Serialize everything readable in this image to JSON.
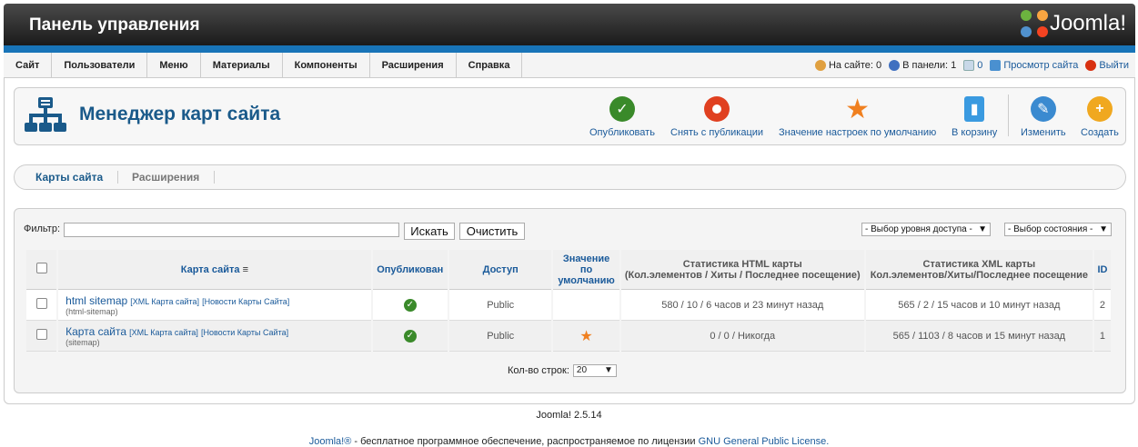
{
  "header": {
    "title": "Панель управления",
    "logo_text": "Joomla!"
  },
  "menu": [
    {
      "name": "menu-site",
      "label": "Сайт"
    },
    {
      "name": "menu-users",
      "label": "Пользователи"
    },
    {
      "name": "menu-menus",
      "label": "Меню"
    },
    {
      "name": "menu-content",
      "label": "Материалы"
    },
    {
      "name": "menu-components",
      "label": "Компоненты"
    },
    {
      "name": "menu-extensions",
      "label": "Расширения"
    },
    {
      "name": "menu-help",
      "label": "Справка"
    }
  ],
  "status": {
    "on_site": "На сайте: 0",
    "in_panel": "В панели: 1",
    "messages": "0",
    "view_site": "Просмотр сайта",
    "logout": "Выйти"
  },
  "page": {
    "title": "Менеджер карт сайта"
  },
  "toolbar": {
    "publish": "Опубликовать",
    "unpublish": "Снять с публикации",
    "default": "Значение настроек по умолчанию",
    "trash": "В корзину",
    "edit": "Изменить",
    "create": "Создать"
  },
  "tabs": {
    "sitemaps": "Карты сайта",
    "extensions": "Расширения"
  },
  "filter": {
    "label": "Фильтр:",
    "value": "",
    "search": "Искать",
    "clear": "Очистить",
    "access": "- Выбор уровня доступа -",
    "state": "- Выбор состояния -"
  },
  "table": {
    "headers": {
      "sitemap": "Карта сайта",
      "published": "Опубликован",
      "access": "Доступ",
      "default_1": "Значение",
      "default_2": "по",
      "default_3": "умолчанию",
      "html_1": "Статистика HTML карты",
      "html_2": "(Кол.элементов / Хиты / Последнее посещение)",
      "xml_1": "Статистика XML карты",
      "xml_2": "Кол.элементов/Хиты/Последнее посещение",
      "id": "ID"
    },
    "rows": [
      {
        "name": "html sitemap",
        "link_xml": "[XML Карта сайта]",
        "link_news": "[Новости Карты Сайта]",
        "alias": "(html-sitemap)",
        "access": "Public",
        "is_default": false,
        "html_stats": "580 / 10 / 6 часов и 23 минут назад",
        "xml_stats": "565 / 2 / 15 часов и 10 минут назад",
        "id": "2"
      },
      {
        "name": "Карта сайта",
        "link_xml": "[XML Карта сайта]",
        "link_news": "[Новости Карты Сайта]",
        "alias": "(sitemap)",
        "access": "Public",
        "is_default": true,
        "html_stats": "0 / 0 / Никогда",
        "xml_stats": "565 / 1103 / 8 часов и 15 минут назад",
        "id": "1"
      }
    ]
  },
  "pager": {
    "label": "Кол-во строк:",
    "value": "20"
  },
  "footer": {
    "version": "Joomla! 2.5.14",
    "license_pre": "Joomla!®",
    "license_mid": " - бесплатное программное обеспечение, распространяемое по лицензии ",
    "license_link": "GNU General Public License."
  },
  "colors": {
    "accent_blue": "#1874b8",
    "publish_green": "#3a8a2a",
    "unpublish_red": "#e04020",
    "star_orange": "#f08020"
  }
}
